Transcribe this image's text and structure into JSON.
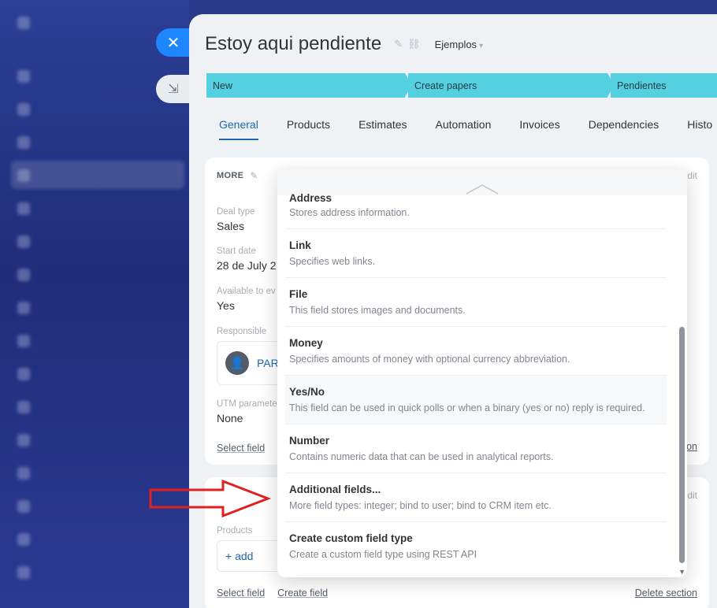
{
  "deal": {
    "title": "Estoy aqui pendiente",
    "category": "Ejemplos"
  },
  "stages": [
    {
      "label": "New"
    },
    {
      "label": "Create papers"
    },
    {
      "label": "Pendientes"
    }
  ],
  "tabs": [
    {
      "label": "General"
    },
    {
      "label": "Products"
    },
    {
      "label": "Estimates"
    },
    {
      "label": "Automation"
    },
    {
      "label": "Invoices"
    },
    {
      "label": "Dependencies"
    },
    {
      "label": "Histo"
    }
  ],
  "card1": {
    "header": "MORE",
    "edit": "dit",
    "fields": [
      {
        "label": "Deal type",
        "value": "Sales"
      },
      {
        "label": "Start date",
        "value": "28 de July 2"
      },
      {
        "label": "Available to ev",
        "value": "Yes"
      },
      {
        "label": "Responsible",
        "value": "PAR"
      },
      {
        "label": "UTM paramete",
        "value": "None"
      }
    ],
    "select_field": "Select field",
    "right_link": "on"
  },
  "card2": {
    "edit": "dit",
    "products_label": "Products",
    "add_label": "+ add",
    "select_field": "Select field",
    "create_field": "Create field",
    "delete_section": "Delete section"
  },
  "popup": {
    "options": [
      {
        "title": "Address",
        "desc": "Stores address information."
      },
      {
        "title": "Link",
        "desc": "Specifies web links."
      },
      {
        "title": "File",
        "desc": "This field stores images and documents."
      },
      {
        "title": "Money",
        "desc": "Specifies amounts of money with optional currency abbreviation."
      },
      {
        "title": "Yes/No",
        "desc": "This field can be used in quick polls or when a binary (yes or no) reply is required."
      },
      {
        "title": "Number",
        "desc": "Contains numeric data that can be used in analytical reports."
      },
      {
        "title": "Additional fields...",
        "desc": "More field types: integer; bind to user; bind to CRM item etc."
      },
      {
        "title": "Create custom field type",
        "desc": "Create a custom field type using REST API"
      }
    ]
  },
  "colors": {
    "stage": "#55d0e0",
    "accent": "#2067b0",
    "close_button": "#1e86ff",
    "arrow": "#e02020"
  }
}
